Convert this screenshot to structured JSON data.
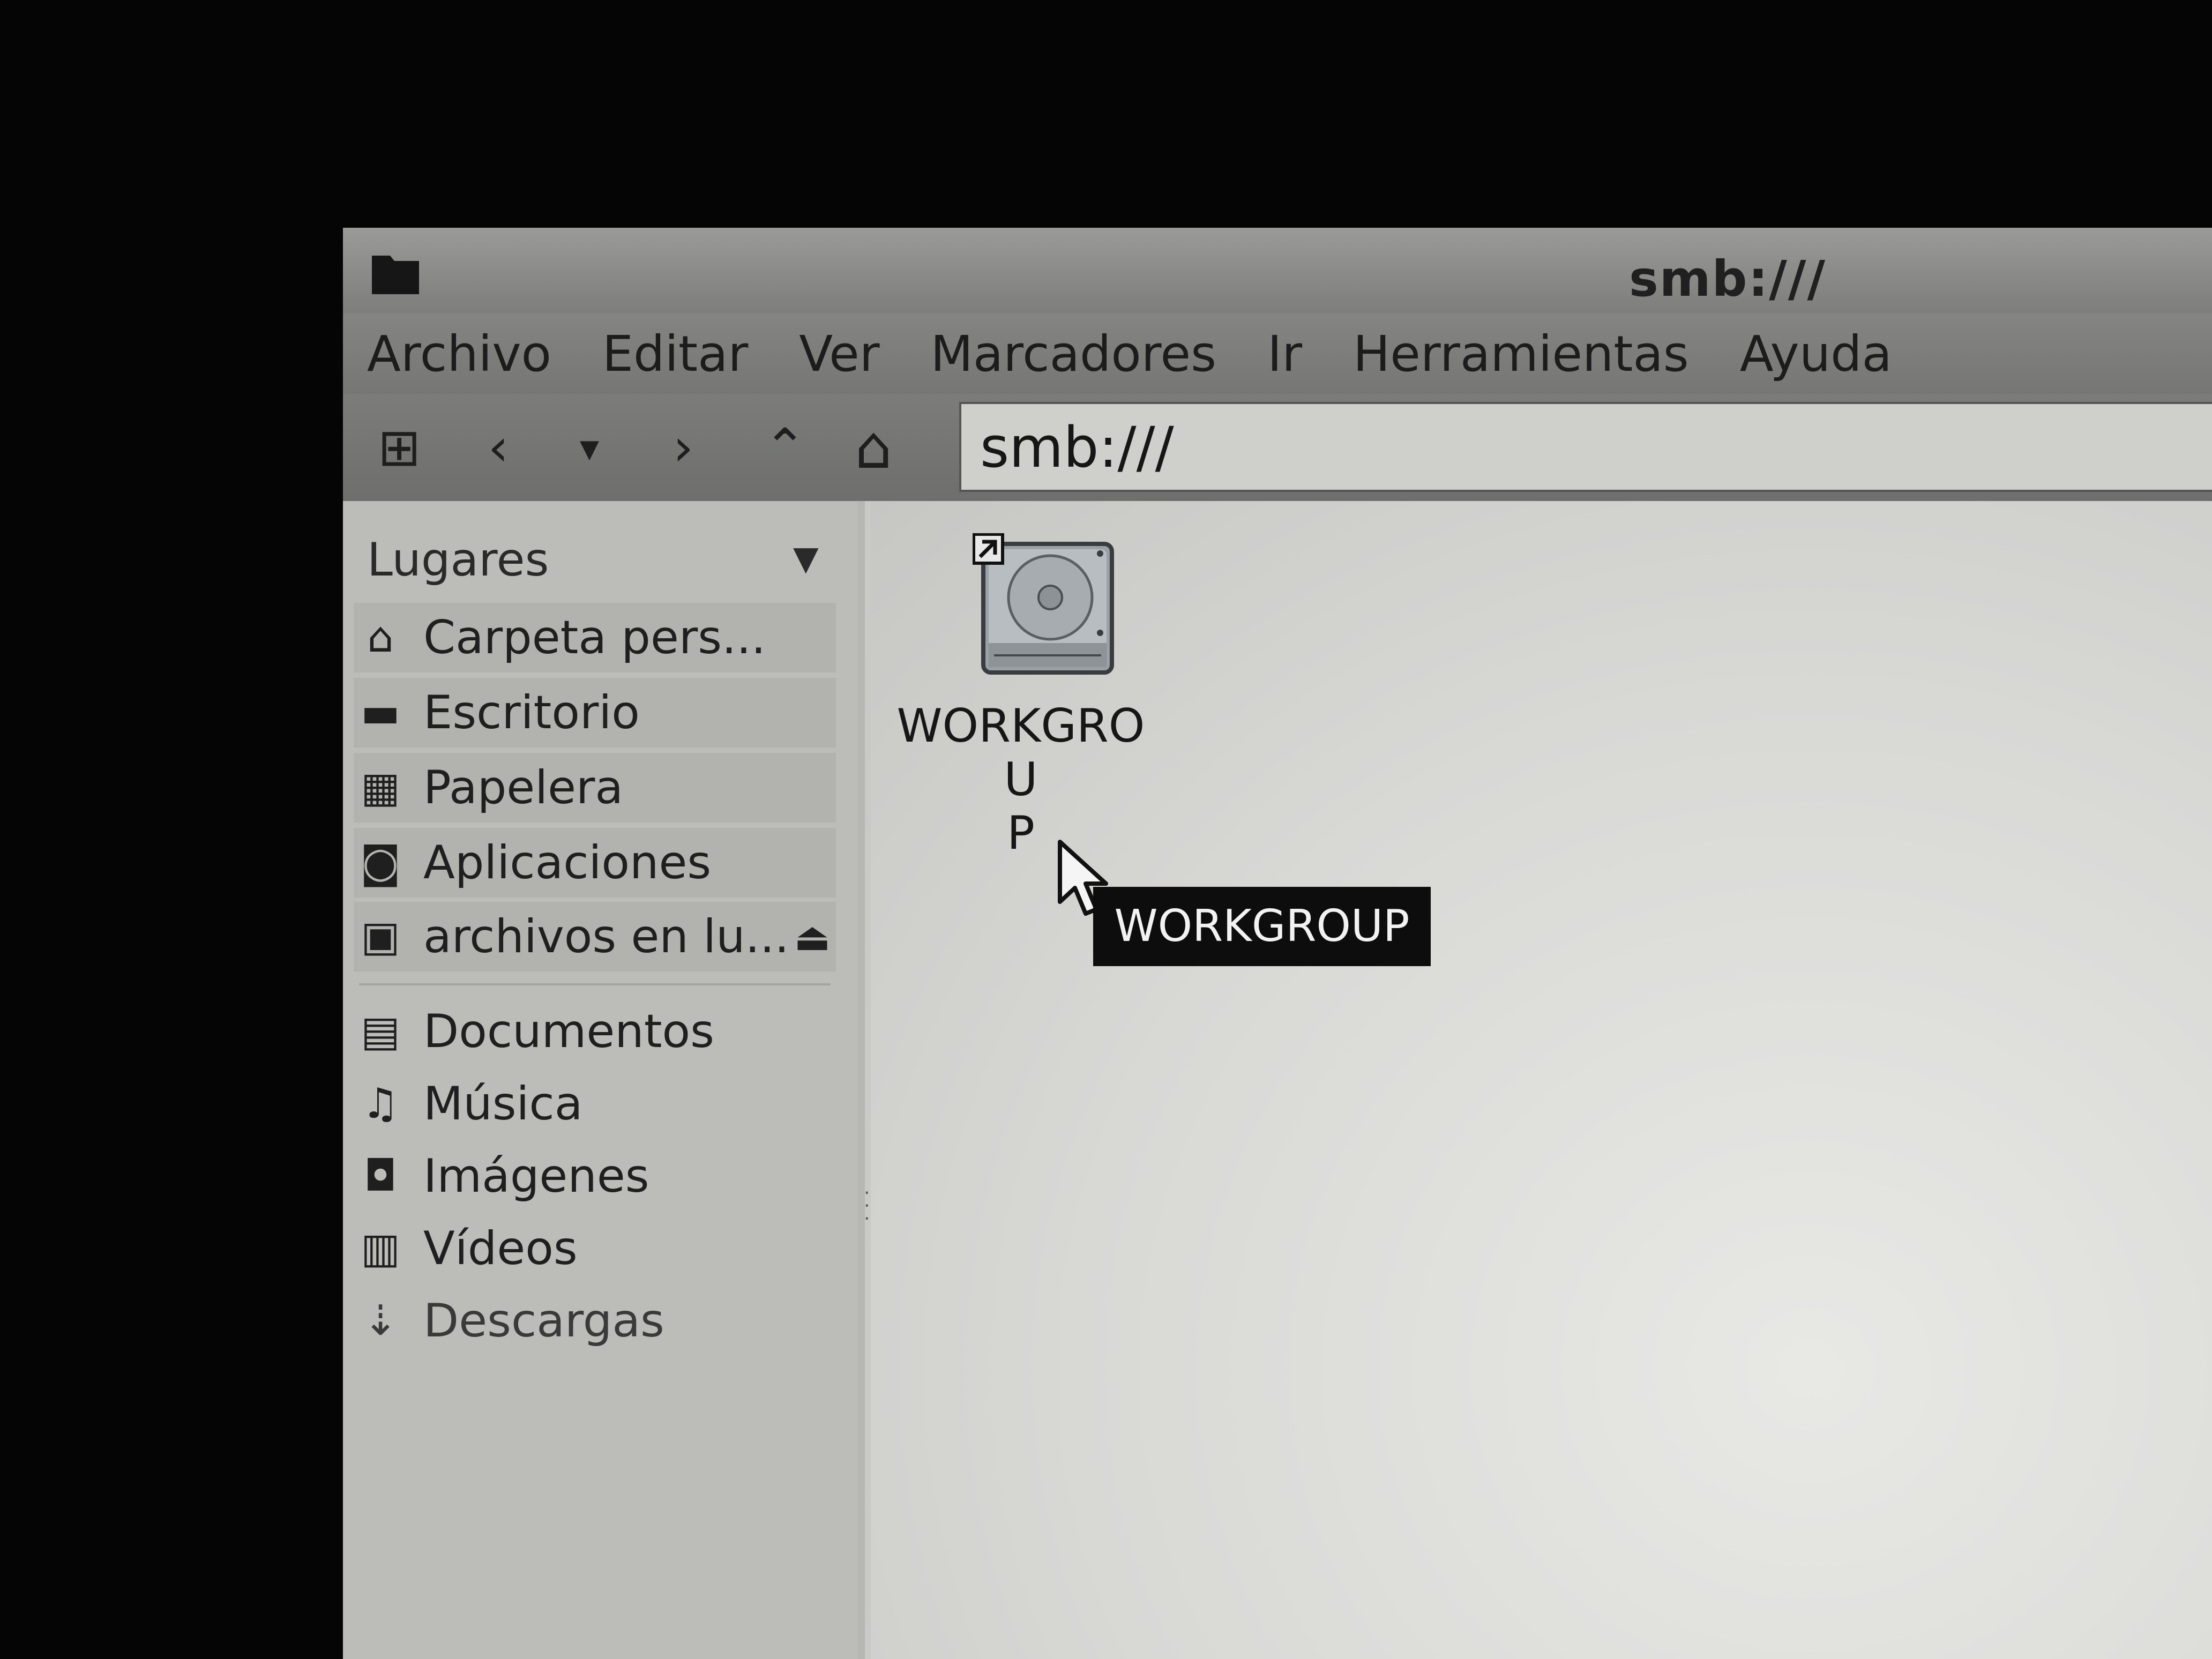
{
  "window": {
    "title": "smb:///",
    "icon": "folder-icon"
  },
  "menubar": {
    "items": [
      {
        "label": "Archivo"
      },
      {
        "label": "Editar"
      },
      {
        "label": "Ver"
      },
      {
        "label": "Marcadores"
      },
      {
        "label": "Ir"
      },
      {
        "label": "Herramientas"
      },
      {
        "label": "Ayuda"
      }
    ]
  },
  "toolbar": {
    "buttons": [
      {
        "name": "new-tab-icon",
        "glyph": "⊞"
      },
      {
        "name": "back-icon",
        "glyph": "‹"
      },
      {
        "name": "history-dropdown-icon",
        "glyph": "▾"
      },
      {
        "name": "forward-icon",
        "glyph": "›"
      },
      {
        "name": "up-icon",
        "glyph": "⌃"
      },
      {
        "name": "home-icon",
        "glyph": "⌂"
      }
    ],
    "location": "smb:///"
  },
  "sidebar": {
    "header": "Lugares",
    "places": [
      {
        "label": "Carpeta pers...",
        "icon": "home-icon",
        "glyph": "⌂"
      },
      {
        "label": "Escritorio",
        "icon": "desktop-icon",
        "glyph": "▬"
      },
      {
        "label": "Papelera",
        "icon": "trash-icon",
        "glyph": "▦"
      },
      {
        "label": "Aplicaciones",
        "icon": "applications-icon",
        "glyph": "◙"
      },
      {
        "label": "archivos en lu...",
        "icon": "network-drive-icon",
        "glyph": "▣",
        "eject": "⏏"
      }
    ],
    "bookmarks": [
      {
        "label": "Documentos",
        "icon": "documents-icon",
        "glyph": "▤"
      },
      {
        "label": "Música",
        "icon": "music-icon",
        "glyph": "♫"
      },
      {
        "label": "Imágenes",
        "icon": "pictures-icon",
        "glyph": "◘"
      },
      {
        "label": "Vídeos",
        "icon": "videos-icon",
        "glyph": "▥"
      },
      {
        "label": "Descargas",
        "icon": "downloads-icon",
        "glyph": "⇣"
      }
    ]
  },
  "content": {
    "items": [
      {
        "label": "WORKGROUP",
        "icon": "network-share-icon",
        "label_line1": "WORKGROU",
        "label_line2": "P"
      }
    ],
    "tooltip": "WORKGROUP"
  }
}
